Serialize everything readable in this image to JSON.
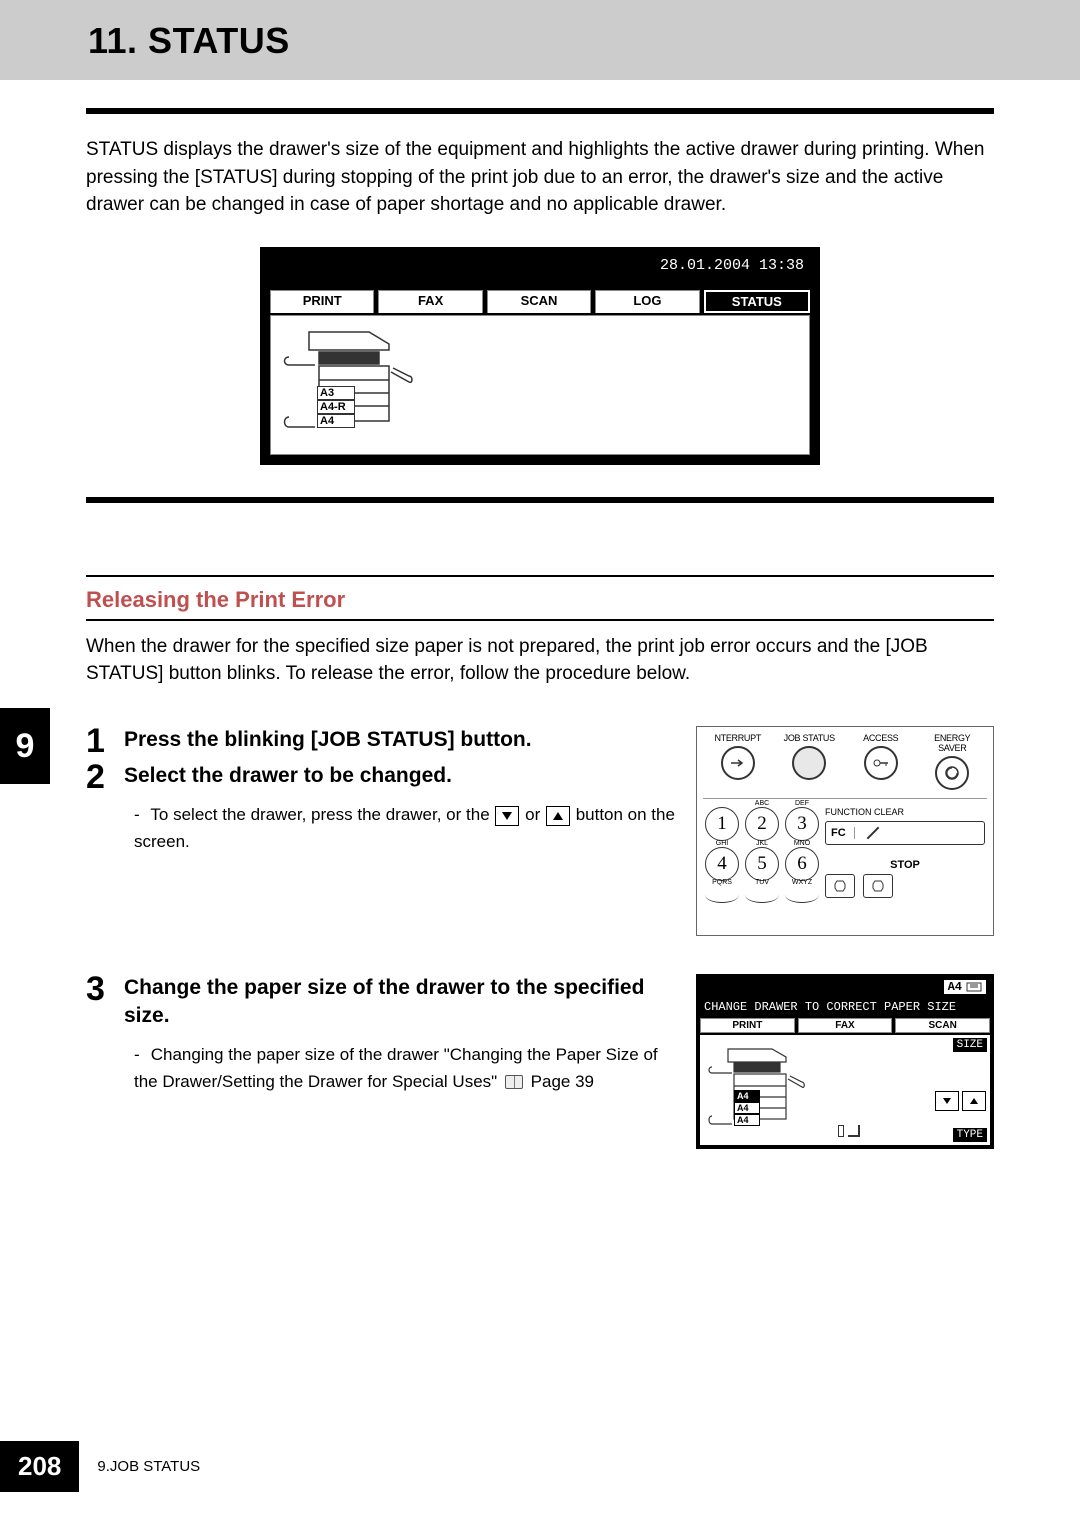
{
  "chapter_tab": "9",
  "title": "11. STATUS",
  "intro": "STATUS displays the drawer's size of the equipment and highlights the active drawer during printing. When pressing the [STATUS] during stopping of the print job due to an error, the drawer's size and the active drawer can be changed in case of paper shortage and no applicable drawer.",
  "screenshot1": {
    "timestamp": "28.01.2004 13:38",
    "tabs": [
      "PRINT",
      "FAX",
      "SCAN",
      "LOG",
      "STATUS"
    ],
    "active_tab": "STATUS",
    "drawers": [
      "A3",
      "A4-R",
      "A4"
    ]
  },
  "subhead": "Releasing the Print Error",
  "subintro": "When the drawer for the specified size paper is not prepared, the print job error occurs and the [JOB STATUS] button blinks. To release the error, follow the procedure below.",
  "steps": {
    "s1": {
      "num": "1",
      "head": "Press the blinking [JOB STATUS] button."
    },
    "s2": {
      "num": "2",
      "head": "Select the drawer to be changed.",
      "body_pre": "To select the drawer, press the drawer, or the ",
      "body_mid": " or ",
      "body_post": " button on the screen."
    },
    "s3": {
      "num": "3",
      "head": "Change the paper size of the drawer to the specified size.",
      "body_pre": "Changing the paper size of the drawer \"Changing the Paper Size of the Drawer/Setting the Drawer for Special Uses\" ",
      "body_post": " Page 39"
    }
  },
  "panel": {
    "labels": [
      "NTERRUPT",
      "JOB STATUS",
      "ACCESS",
      "ENERGY\nSAVER"
    ],
    "func_clear": "FUNCTION CLEAR",
    "fc": "FC",
    "stop": "STOP",
    "keypad_sup": [
      "",
      "ABC",
      "DEF",
      "GHI",
      "JKL",
      "MNO",
      "PQRS",
      "TUV",
      "WXYZ"
    ]
  },
  "screenshot3": {
    "a4": "A4",
    "message": "CHANGE DRAWER TO CORRECT PAPER SIZE",
    "tabs": [
      "PRINT",
      "FAX",
      "SCAN"
    ],
    "size_lbl": "SIZE",
    "type_lbl": "TYPE",
    "drawers": [
      "A4",
      "A4",
      "A4"
    ]
  },
  "footer": {
    "page": "208",
    "text": "9.JOB STATUS"
  }
}
